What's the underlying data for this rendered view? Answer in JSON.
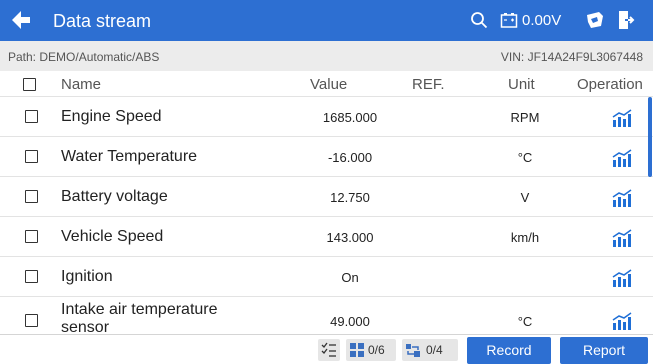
{
  "header": {
    "title": "Data stream",
    "voltage": "0.00V"
  },
  "pathbar": {
    "path": "Path: DEMO/Automatic/ABS",
    "vin": "VIN: JF14A24F9L3067448"
  },
  "columns": {
    "name": "Name",
    "value": "Value",
    "ref": "REF.",
    "unit": "Unit",
    "operation": "Operation"
  },
  "rows": [
    {
      "name": "Engine Speed",
      "value": "1685.000",
      "unit": "RPM"
    },
    {
      "name": "Water Temperature",
      "value": "-16.000",
      "unit": "°C"
    },
    {
      "name": "Battery voltage",
      "value": "12.750",
      "unit": "V"
    },
    {
      "name": "Vehicle Speed",
      "value": "143.000",
      "unit": "km/h"
    },
    {
      "name": "Ignition",
      "value": "On",
      "unit": ""
    },
    {
      "name": "Intake air temperature sensor",
      "value": "49.000",
      "unit": "°C"
    }
  ],
  "footer": {
    "selected_count": "0/6",
    "compare_count": "0/4",
    "record_label": "Record",
    "report_label": "Report"
  },
  "colors": {
    "accent": "#2d6fd2",
    "graph_icon": "#1f6fd6"
  },
  "icons": [
    "back-arrow-icon",
    "search-icon",
    "battery-icon",
    "car-icon",
    "exit-icon",
    "graph-icon",
    "select-all-icon",
    "combine-graph-icon",
    "compare-icon"
  ]
}
